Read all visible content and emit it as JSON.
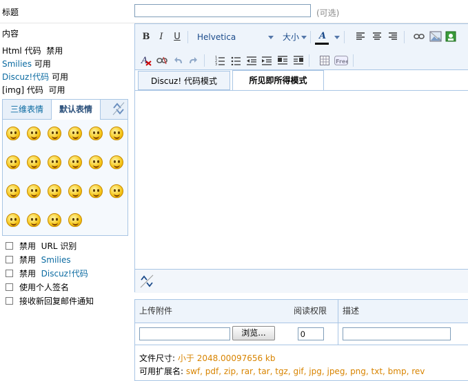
{
  "form": {
    "title_label": "标题",
    "title_value": "",
    "title_hint": "(可选)",
    "content_label": "内容"
  },
  "rules": {
    "html_prefix": "Html 代码",
    "html_status": "禁用",
    "smilies_link": "Smilies",
    "smilies_status": "可用",
    "discuz_link": "Discuz!代码",
    "discuz_status": "可用",
    "img_prefix": "[img] 代码",
    "img_status": "可用"
  },
  "smilies": {
    "tabs": [
      {
        "label": "三维表情"
      },
      {
        "label": "默认表情"
      }
    ],
    "active_tab": "默认表情",
    "icons": [
      "smile",
      "sad",
      "smile2",
      "blush",
      "grin",
      "tongue",
      "yawn",
      "angry",
      "shout",
      "cry",
      "shock",
      "wink",
      "point-left",
      "point-right",
      "victory",
      "handshake",
      "laugh",
      "smile3",
      "hug",
      "kiss",
      "clock",
      "phone"
    ]
  },
  "options": [
    {
      "prefix": "禁用",
      "label": "URL 识别",
      "link": false,
      "checked": false
    },
    {
      "prefix": "禁用",
      "label": "Smilies",
      "link": true,
      "checked": false
    },
    {
      "prefix": "禁用",
      "label": "Discuz!代码",
      "link": true,
      "checked": false
    },
    {
      "prefix": "",
      "label": "使用个人签名",
      "link": false,
      "checked": false
    },
    {
      "prefix": "",
      "label": "接收新回复邮件通知",
      "link": false,
      "checked": false
    }
  ],
  "editor": {
    "font_family": "Helvetica",
    "font_size_label": "大小",
    "mode_tabs": [
      {
        "label": "Discuz! 代码模式"
      },
      {
        "label": "所见即所得模式"
      }
    ],
    "active_mode": "所见即所得模式",
    "body_text": ""
  },
  "attachments": {
    "col_upload": "上传附件",
    "col_permission": "阅读权限",
    "col_description": "描述",
    "browse_label": "浏览...",
    "permission_value": "0",
    "size_label": "文件尺寸:",
    "size_value": "小于  2048.00097656 kb",
    "ext_label": "可用扩展名:",
    "ext_value": "swf, pdf, zip, rar, tar, tgz, gif, jpg, jpeg, png, txt, bmp, rev"
  },
  "colors": {
    "link": "#0a6aa1",
    "border": "#a8c5e4",
    "toolbar_bg": "#eef4fb",
    "info_orange": "#d88400"
  }
}
